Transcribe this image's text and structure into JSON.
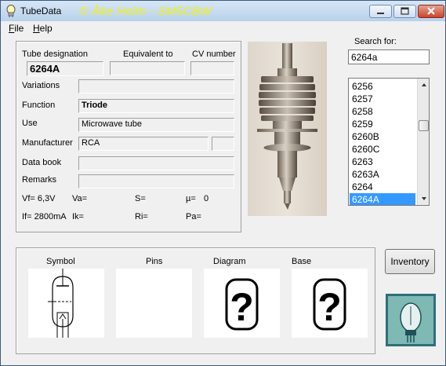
{
  "window": {
    "title": "TubeData",
    "banner": "© Åke Holm - SM5CBW"
  },
  "menu": [
    {
      "label_underlined": "F",
      "label_rest": "ile"
    },
    {
      "label_underlined": "H",
      "label_rest": "elp"
    }
  ],
  "details": {
    "tube_designation_label": "Tube designation",
    "equivalent_label": "Equivalent to",
    "cv_label": "CV number",
    "tube_designation_value": "6264A",
    "equivalent_value": "",
    "cv_value": "",
    "variations_label": "Variations",
    "variations_value": "",
    "function_label": "Function",
    "function_value": "Triode",
    "use_label": "Use",
    "use_value": "Microwave tube",
    "manufacturer_label": "Manufacturer",
    "manufacturer_value": "RCA",
    "manufacturer_extra": "",
    "databook_label": "Data book",
    "databook_value": "",
    "remarks_label": "Remarks",
    "remarks_value": ""
  },
  "params": {
    "vf": "Vf= 6,3V",
    "va": "Va=",
    "s": "S=",
    "mu": "µ=",
    "mu_value": "0",
    "if": "If= 2800mA",
    "ik": "Ik=",
    "ri": "Ri=",
    "pa": "Pa="
  },
  "search": {
    "label": "Search for:",
    "value": "6264a"
  },
  "list": {
    "items": [
      "6256",
      "6257",
      "6258",
      "6259",
      "6260B",
      "6260C",
      "6263",
      "6263A",
      "6264",
      "6264A"
    ],
    "selected": "6264A",
    "scroll_position": 0.4
  },
  "images": {
    "symbol_label": "Symbol",
    "pins_label": "Pins",
    "diagram_label": "Diagram",
    "base_label": "Base"
  },
  "buttons": {
    "inventory": "Inventory"
  },
  "colors": {
    "banner": "#f3f300",
    "selection": "#3399ff",
    "window_bg": "#f0f0f0"
  }
}
